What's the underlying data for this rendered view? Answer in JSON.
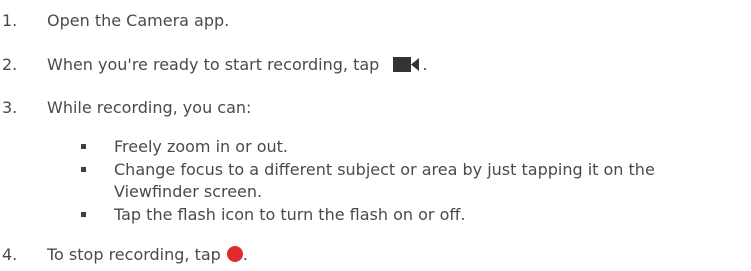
{
  "steps": [
    {
      "number": "1.",
      "text": "Open the Camera app."
    },
    {
      "number": "2.",
      "text": "When you're ready to start recording, tap",
      "suffix": "."
    },
    {
      "number": "3.",
      "text": "While recording, you can:"
    },
    {
      "number": "4.",
      "text": "To stop recording, tap",
      "suffix": "."
    }
  ],
  "bullets": [
    "Freely zoom in or out.",
    "Change focus to a different subject or area by just tapping it on the Viewfinder screen.",
    "Tap the flash icon to turn the flash on or off."
  ],
  "icons": {
    "record_button": "video-camera-icon",
    "stop_button": "stop-record-icon"
  },
  "colors": {
    "text": "#4a4a4a",
    "icon": "#333333",
    "record": "#e12b2b"
  }
}
